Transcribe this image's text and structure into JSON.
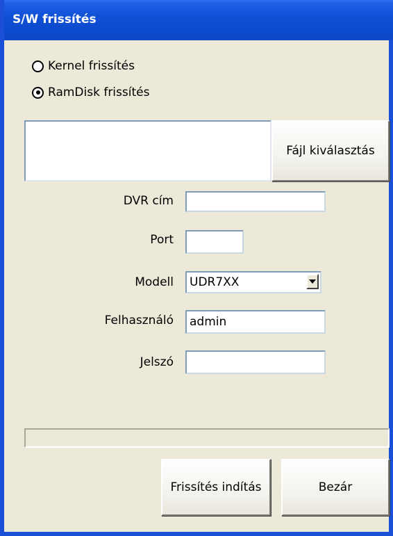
{
  "window": {
    "title": "S/W frissítés"
  },
  "update_type": {
    "options": [
      {
        "label": "Kernel frissítés",
        "checked": false
      },
      {
        "label": "RamDisk frissítés",
        "checked": true
      }
    ]
  },
  "file": {
    "selected_path": "",
    "select_button_label": "Fájl kiválasztás"
  },
  "form": {
    "dvr_address": {
      "label": "DVR cím",
      "value": ""
    },
    "port": {
      "label": "Port",
      "value": ""
    },
    "model": {
      "label": "Modell",
      "value": "UDR7XX"
    },
    "user": {
      "label": "Felhasználó",
      "value": "admin"
    },
    "password": {
      "label": "Jelszó",
      "value": ""
    }
  },
  "progress": {
    "value": 0
  },
  "actions": {
    "start_label": "Frissítés indítás",
    "close_label": "Bezár"
  },
  "colors": {
    "title_bar": "#0f4fd4",
    "dialog_background": "#ece9d8",
    "input_border": "#7f9db9"
  }
}
